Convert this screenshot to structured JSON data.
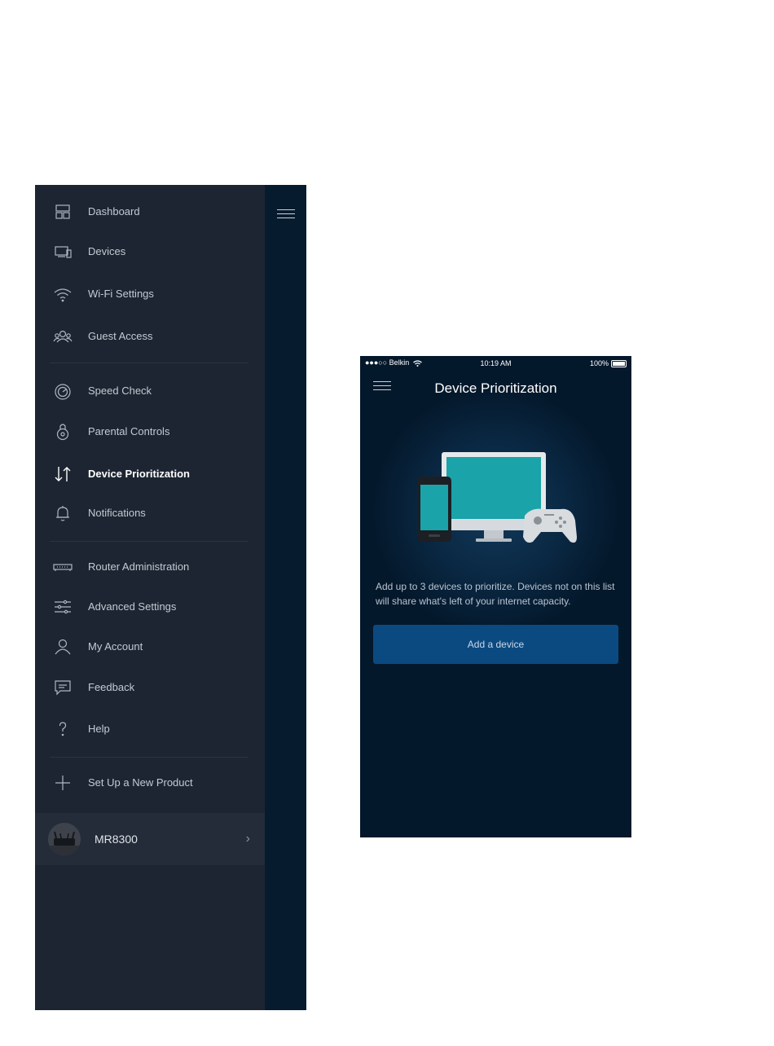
{
  "drawer": {
    "items": [
      {
        "label": "Dashboard",
        "icon": "dashboard-icon"
      },
      {
        "label": "Devices",
        "icon": "devices-icon"
      },
      {
        "label": "Wi-Fi Settings",
        "icon": "wifi-icon"
      },
      {
        "label": "Guest Access",
        "icon": "guest-access-icon"
      },
      {
        "label": "Speed Check",
        "icon": "speedometer-icon"
      },
      {
        "label": "Parental Controls",
        "icon": "parental-controls-icon"
      },
      {
        "label": "Device Prioritization",
        "icon": "prioritization-arrows-icon",
        "active": true
      },
      {
        "label": "Notifications",
        "icon": "bell-icon"
      },
      {
        "label": "Router Administration",
        "icon": "router-icon"
      },
      {
        "label": "Advanced Settings",
        "icon": "sliders-icon"
      },
      {
        "label": "My Account",
        "icon": "user-icon"
      },
      {
        "label": "Feedback",
        "icon": "chat-bubble-icon"
      },
      {
        "label": "Help",
        "icon": "question-mark-icon"
      },
      {
        "label": "Set Up a New Product",
        "icon": "plus-icon"
      }
    ],
    "router": {
      "name": "MR8300",
      "chevron": "›"
    }
  },
  "status_bar": {
    "carrier": "●●●○○ Belkin",
    "time": "10:19 AM",
    "battery": "100%"
  },
  "device_prioritization": {
    "title": "Device Prioritization",
    "description": "Add up to 3 devices to prioritize. Devices not on this list will share what's left of your internet capacity.",
    "add_button": "Add a device"
  },
  "colors": {
    "drawer_bg": "#1d2532",
    "screen_bg": "#04182b",
    "button_bg": "#0b4a80",
    "illustration_teal": "#1aa3a8"
  }
}
